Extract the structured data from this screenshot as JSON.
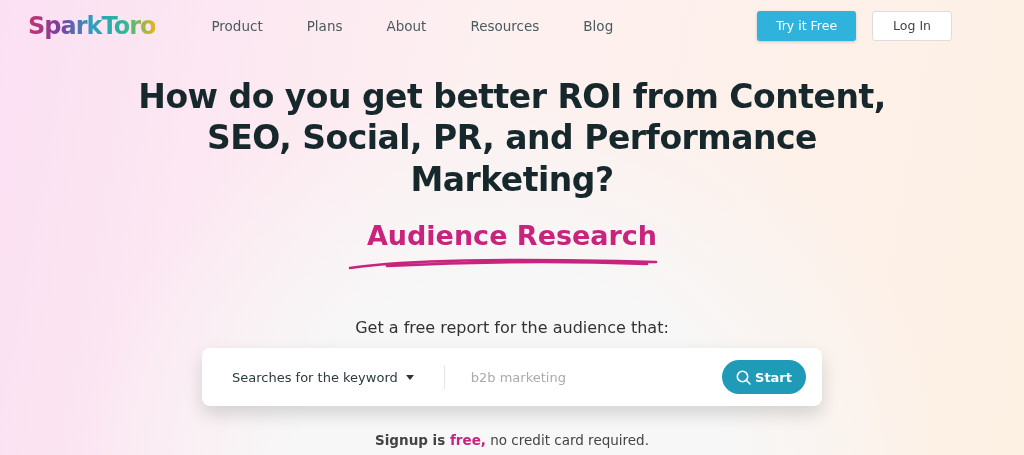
{
  "logo": "SparkToro",
  "nav": [
    {
      "label": "Product"
    },
    {
      "label": "Plans"
    },
    {
      "label": "About"
    },
    {
      "label": "Resources"
    },
    {
      "label": "Blog"
    }
  ],
  "actions": {
    "primary": "Try it Free",
    "secondary": "Log In"
  },
  "headline": "How do you get better ROI from Content, SEO, Social, PR, and Performance Marketing?",
  "highlight": "Audience Research",
  "prompt": "Get a free report for the audience that:",
  "search": {
    "mode": "Searches for the keyword",
    "placeholder": "b2b marketing",
    "button": "Start"
  },
  "signup": {
    "lead": "Signup is",
    "accent": "free,",
    "rest": "no credit card required."
  }
}
